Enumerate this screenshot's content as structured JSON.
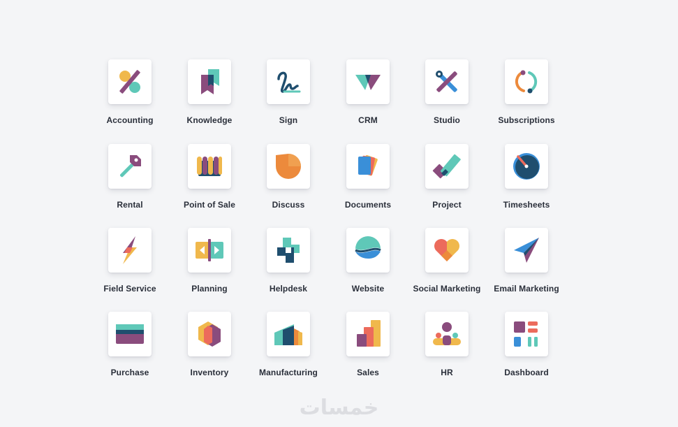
{
  "apps": [
    {
      "label": "Accounting",
      "icon": "accounting-icon"
    },
    {
      "label": "Knowledge",
      "icon": "knowledge-icon"
    },
    {
      "label": "Sign",
      "icon": "sign-icon"
    },
    {
      "label": "CRM",
      "icon": "crm-icon"
    },
    {
      "label": "Studio",
      "icon": "studio-icon"
    },
    {
      "label": "Subscriptions",
      "icon": "subscriptions-icon"
    },
    {
      "label": "Rental",
      "icon": "rental-icon"
    },
    {
      "label": "Point of Sale",
      "icon": "point-of-sale-icon"
    },
    {
      "label": "Discuss",
      "icon": "discuss-icon"
    },
    {
      "label": "Documents",
      "icon": "documents-icon"
    },
    {
      "label": "Project",
      "icon": "project-icon"
    },
    {
      "label": "Timesheets",
      "icon": "timesheets-icon"
    },
    {
      "label": "Field Service",
      "icon": "field-service-icon"
    },
    {
      "label": "Planning",
      "icon": "planning-icon"
    },
    {
      "label": "Helpdesk",
      "icon": "helpdesk-icon"
    },
    {
      "label": "Website",
      "icon": "website-icon"
    },
    {
      "label": "Social Marketing",
      "icon": "social-marketing-icon"
    },
    {
      "label": "Email Marketing",
      "icon": "email-marketing-icon"
    },
    {
      "label": "Purchase",
      "icon": "purchase-icon"
    },
    {
      "label": "Inventory",
      "icon": "inventory-icon"
    },
    {
      "label": "Manufacturing",
      "icon": "manufacturing-icon"
    },
    {
      "label": "Sales",
      "icon": "sales-icon"
    },
    {
      "label": "HR",
      "icon": "hr-icon"
    },
    {
      "label": "Dashboard",
      "icon": "dashboard-icon"
    }
  ],
  "watermark": "خمسات",
  "colors": {
    "background": "#f4f5f7",
    "tile": "#ffffff",
    "label": "#2a2f3a",
    "purple": "#8a4c7d",
    "teal": "#5fc8b8",
    "yellow": "#f0b84c",
    "orange": "#ec8a3c",
    "navy": "#1f4e6e",
    "blue": "#3a8fd8"
  }
}
